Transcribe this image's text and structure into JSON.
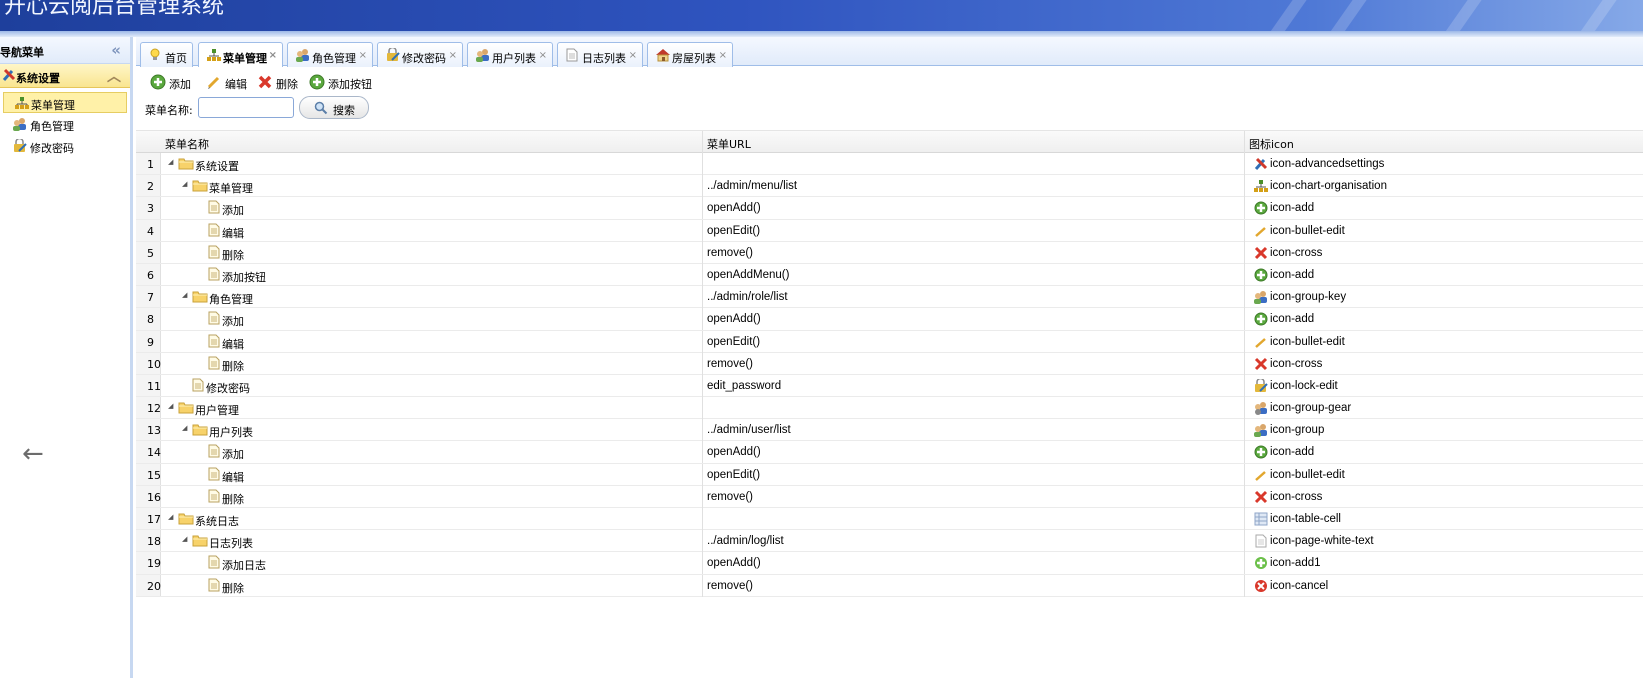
{
  "app": {
    "title": "开心云阅后台管理系统"
  },
  "west": {
    "title": "导航菜单",
    "section": "系统设置",
    "items": [
      {
        "label": "菜单管理",
        "icon": "chart-organisation-icon"
      },
      {
        "label": "角色管理",
        "icon": "group-key-icon"
      },
      {
        "label": "修改密码",
        "icon": "lock-edit-icon"
      }
    ]
  },
  "tabs": [
    {
      "label": "首页",
      "icon": "lightbulb-icon",
      "closable": false
    },
    {
      "label": "菜单管理",
      "icon": "chart-organisation-icon",
      "closable": true,
      "active": true
    },
    {
      "label": "角色管理",
      "icon": "group-key-icon",
      "closable": true
    },
    {
      "label": "修改密码",
      "icon": "lock-edit-icon",
      "closable": true
    },
    {
      "label": "用户列表",
      "icon": "group-icon",
      "closable": true
    },
    {
      "label": "日志列表",
      "icon": "page-white-text-icon",
      "closable": true
    },
    {
      "label": "房屋列表",
      "icon": "house-icon",
      "closable": true
    }
  ],
  "toolbar": {
    "add": "添加",
    "edit": "编辑",
    "remove": "删除",
    "add_button": "添加按钮"
  },
  "search": {
    "label": "菜单名称:",
    "value": "",
    "button": "搜索"
  },
  "grid": {
    "headers": {
      "name": "菜单名称",
      "url": "菜单URL",
      "icon": "图标icon"
    },
    "rows": [
      {
        "n": "1",
        "name": "系统设置",
        "url": "",
        "icon": "icon-advancedsettings"
      },
      {
        "n": "2",
        "name": "菜单管理",
        "url": "../admin/menu/list",
        "icon": "icon-chart-organisation"
      },
      {
        "n": "3",
        "name": "添加",
        "url": "openAdd()",
        "icon": "icon-add"
      },
      {
        "n": "4",
        "name": "编辑",
        "url": "openEdit()",
        "icon": "icon-bullet-edit"
      },
      {
        "n": "5",
        "name": "删除",
        "url": "remove()",
        "icon": "icon-cross"
      },
      {
        "n": "6",
        "name": "添加按钮",
        "url": "openAddMenu()",
        "icon": "icon-add"
      },
      {
        "n": "7",
        "name": "角色管理",
        "url": "../admin/role/list",
        "icon": "icon-group-key"
      },
      {
        "n": "8",
        "name": "添加",
        "url": "openAdd()",
        "icon": "icon-add"
      },
      {
        "n": "9",
        "name": "编辑",
        "url": "openEdit()",
        "icon": "icon-bullet-edit"
      },
      {
        "n": "10",
        "name": "删除",
        "url": "remove()",
        "icon": "icon-cross"
      },
      {
        "n": "11",
        "name": "修改密码",
        "url": "edit_password",
        "icon": "icon-lock-edit"
      },
      {
        "n": "12",
        "name": "用户管理",
        "url": "",
        "icon": "icon-group-gear"
      },
      {
        "n": "13",
        "name": "用户列表",
        "url": "../admin/user/list",
        "icon": "icon-group"
      },
      {
        "n": "14",
        "name": "添加",
        "url": "openAdd()",
        "icon": "icon-add"
      },
      {
        "n": "15",
        "name": "编辑",
        "url": "openEdit()",
        "icon": "icon-bullet-edit"
      },
      {
        "n": "16",
        "name": "删除",
        "url": "remove()",
        "icon": "icon-cross"
      },
      {
        "n": "17",
        "name": "系统日志",
        "url": "",
        "icon": "icon-table-cell"
      },
      {
        "n": "18",
        "name": "日志列表",
        "url": "../admin/log/list",
        "icon": "icon-page-white-text"
      },
      {
        "n": "19",
        "name": "添加日志",
        "url": "openAdd()",
        "icon": "icon-add1"
      },
      {
        "n": "20",
        "name": "删除",
        "url": "remove()",
        "icon": "icon-cancel"
      }
    ]
  },
  "colors": {
    "banner": "#2f54bf",
    "selected": "#fff1a8",
    "border": "#9fbde8"
  }
}
